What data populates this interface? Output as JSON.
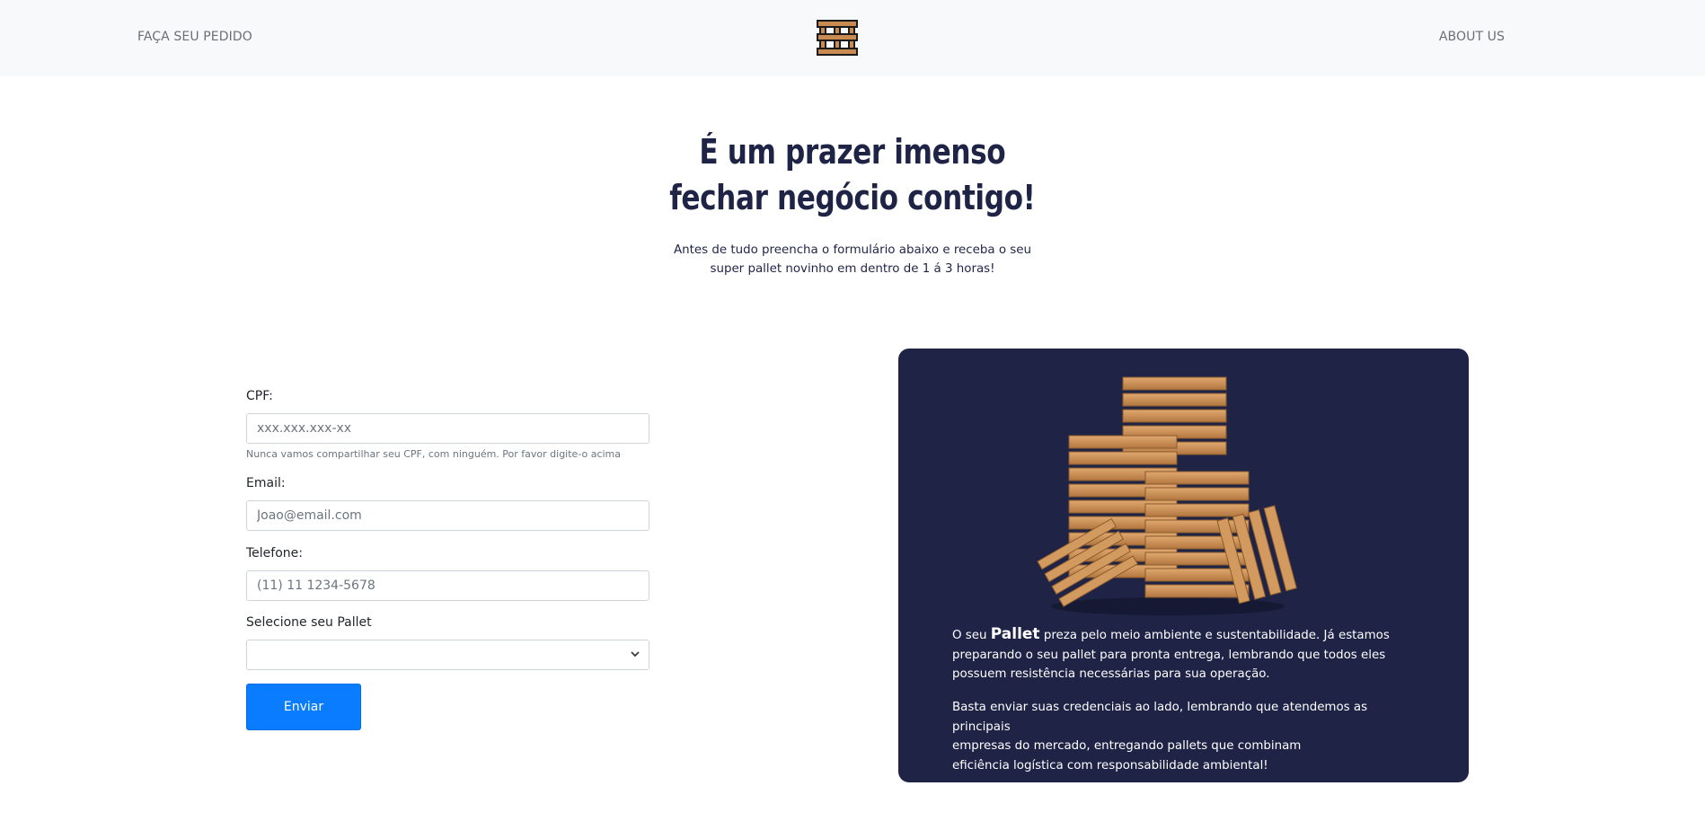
{
  "navbar": {
    "left_link": "FAÇA SEU PEDIDO",
    "right_link": "ABOUT US",
    "logo_icon": "pallet-logo-icon"
  },
  "hero": {
    "title_line1": "É um prazer imenso",
    "title_line2": "fechar negócio contigo!",
    "subtitle_line1": "Antes de tudo preencha o formulário abaixo e receba o seu",
    "subtitle_line2": "super pallet novinho em dentro de 1 á 3 horas!"
  },
  "form": {
    "cpf_label": "CPF:",
    "cpf_placeholder": "xxx.xxx.xxx-xx",
    "cpf_help": "Nunca vamos compartilhar seu CPF, com ninguém. Por favor digite-o acima",
    "email_label": "Email:",
    "email_placeholder": "Joao@email.com",
    "phone_label": "Telefone:",
    "phone_placeholder": "(11) 11 1234-5678",
    "pallet_label": "Selecione seu Pallet",
    "pallet_selected": "",
    "submit_label": "Enviar"
  },
  "card": {
    "p1_prefix": "O seu ",
    "p1_strong": "Pallet",
    "p1_rest": " preza pelo meio ambiente e sustentabilidade. Já estamos preparando o seu pallet para pronta entrega, lembrando que todos eles possuem resistência necessárias para sua operação.",
    "p2_line1": "Basta enviar suas credenciais ao lado, lembrando que atendemos as principais",
    "p2_line2": "empresas do mercado, entregando pallets que combinam",
    "p2_line3": "eficiência logística com responsabilidade ambiental!",
    "image_icon": "stacked-pallets-image"
  },
  "colors": {
    "navy": "#1f2447",
    "primary": "#0a7cff",
    "navbar_bg": "#f8f9fa",
    "wood": "#c98b52"
  }
}
